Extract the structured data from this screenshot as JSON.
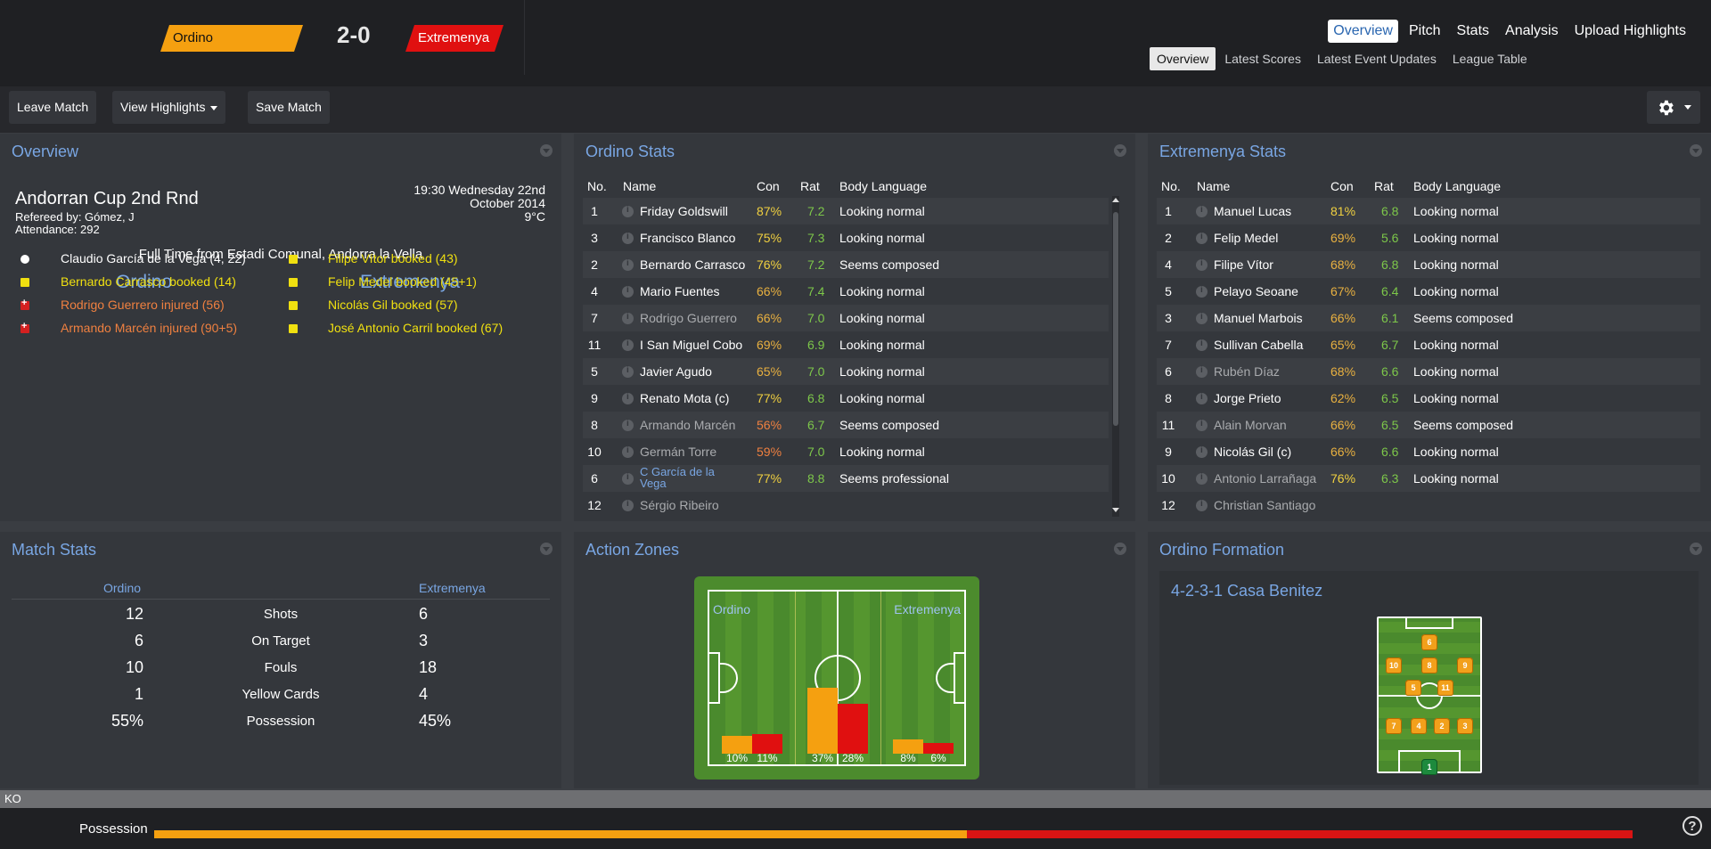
{
  "header": {
    "home_team": "Ordino",
    "away_team": "Extremenya",
    "score": "2-0",
    "colors": {
      "home": "#f5a010",
      "away": "#e01010"
    },
    "nav": [
      "Overview",
      "Pitch",
      "Stats",
      "Analysis",
      "Upload Highlights"
    ],
    "subnav": [
      "Overview",
      "Latest Scores",
      "Latest Event Updates",
      "League Table"
    ]
  },
  "toolbar": {
    "leave": "Leave Match",
    "highlights": "View Highlights",
    "save": "Save Match",
    "settings_icon": "gear-icon"
  },
  "overview": {
    "title": "Overview",
    "competition": "Andorran Cup 2nd Rnd",
    "referee": "Refereed by: Gómez, J",
    "attendance": "Attendance: 292",
    "datetime": "19:30 Wednesday 22nd October 2014",
    "temperature": "9°C",
    "fulltime": "Full Time from Estadi Comunal, Andorra la Vella",
    "home_label": "Ordino",
    "away_label": "Extremenya",
    "home_events": [
      {
        "text": "Claudio García de la Vega (4, 22)",
        "type": "goal"
      },
      {
        "text": "Bernardo Carrasco booked (14)",
        "type": "yellow"
      },
      {
        "text": "Rodrigo Guerrero injured (56)",
        "type": "injury"
      },
      {
        "text": "Armando Marcén injured (90+5)",
        "type": "injury"
      }
    ],
    "away_events": [
      {
        "text": "Filipe Vítor booked (43)",
        "type": "yellow"
      },
      {
        "text": "Felip Medel booked (45+1)",
        "type": "yellow"
      },
      {
        "text": "Nicolás Gil booked (57)",
        "type": "yellow"
      },
      {
        "text": "José Antonio Carril booked (67)",
        "type": "yellow"
      }
    ]
  },
  "stats_headers": {
    "no": "No.",
    "name": "Name",
    "con": "Con",
    "rat": "Rat",
    "body": "Body Language"
  },
  "home_stats": {
    "title": "Ordino Stats",
    "rows": [
      {
        "no": "1",
        "name": "Friday Goldswill",
        "con": "87%",
        "rat": "7.2",
        "body": "Looking normal",
        "dim": false
      },
      {
        "no": "3",
        "name": "Francisco Blanco",
        "con": "75%",
        "rat": "7.3",
        "body": "Looking normal",
        "dim": false
      },
      {
        "no": "2",
        "name": "Bernardo Carrasco",
        "con": "76%",
        "rat": "7.2",
        "body": "Seems composed",
        "dim": false
      },
      {
        "no": "4",
        "name": "Mario Fuentes",
        "con": "66%",
        "rat": "7.4",
        "body": "Looking normal",
        "dim": false
      },
      {
        "no": "7",
        "name": "Rodrigo Guerrero",
        "con": "66%",
        "rat": "7.0",
        "body": "Looking normal",
        "dim": true
      },
      {
        "no": "11",
        "name": "I San Miguel Cobo",
        "con": "69%",
        "rat": "6.9",
        "body": "Looking normal",
        "dim": false
      },
      {
        "no": "5",
        "name": "Javier Agudo",
        "con": "65%",
        "rat": "7.0",
        "body": "Looking normal",
        "dim": false
      },
      {
        "no": "9",
        "name": "Renato Mota (c)",
        "con": "77%",
        "rat": "6.8",
        "body": "Looking normal",
        "dim": false
      },
      {
        "no": "8",
        "name": "Armando Marcén",
        "con": "56%",
        "rat": "6.7",
        "body": "Seems composed",
        "dim": true
      },
      {
        "no": "10",
        "name": "Germán Torre",
        "con": "59%",
        "rat": "7.0",
        "body": "Looking normal",
        "dim": true
      },
      {
        "no": "6",
        "name": "C García de la Vega",
        "con": "77%",
        "rat": "8.8",
        "body": "Seems professional",
        "dim": false,
        "link": true
      },
      {
        "no": "12",
        "name": "Sérgio Ribeiro",
        "con": "",
        "rat": "",
        "body": "",
        "dim": true
      }
    ]
  },
  "away_stats": {
    "title": "Extremenya Stats",
    "rows": [
      {
        "no": "1",
        "name": "Manuel Lucas",
        "con": "81%",
        "rat": "6.8",
        "body": "Looking normal",
        "dim": false
      },
      {
        "no": "2",
        "name": "Felip Medel",
        "con": "69%",
        "rat": "5.6",
        "body": "Looking normal",
        "dim": false
      },
      {
        "no": "4",
        "name": "Filipe Vítor",
        "con": "68%",
        "rat": "6.8",
        "body": "Looking normal",
        "dim": false
      },
      {
        "no": "5",
        "name": "Pelayo Seoane",
        "con": "67%",
        "rat": "6.4",
        "body": "Looking normal",
        "dim": false
      },
      {
        "no": "3",
        "name": "Manuel Marbois",
        "con": "66%",
        "rat": "6.1",
        "body": "Seems composed",
        "dim": false
      },
      {
        "no": "7",
        "name": "Sullivan Cabella",
        "con": "65%",
        "rat": "6.7",
        "body": "Looking normal",
        "dim": false
      },
      {
        "no": "6",
        "name": "Rubén Díaz",
        "con": "68%",
        "rat": "6.6",
        "body": "Looking normal",
        "dim": true
      },
      {
        "no": "8",
        "name": "Jorge Prieto",
        "con": "62%",
        "rat": "6.5",
        "body": "Looking normal",
        "dim": false
      },
      {
        "no": "11",
        "name": "Alain Morvan",
        "con": "66%",
        "rat": "6.5",
        "body": "Seems composed",
        "dim": true
      },
      {
        "no": "9",
        "name": "Nicolás Gil (c)",
        "con": "66%",
        "rat": "6.6",
        "body": "Looking normal",
        "dim": false
      },
      {
        "no": "10",
        "name": "Antonio Larrañaga",
        "con": "76%",
        "rat": "6.3",
        "body": "Looking normal",
        "dim": true
      },
      {
        "no": "12",
        "name": "Christian Santiago",
        "con": "",
        "rat": "",
        "body": "",
        "dim": true
      }
    ]
  },
  "match_stats": {
    "title": "Match Stats",
    "home_label": "Ordino",
    "away_label": "Extremenya",
    "rows": [
      {
        "label": "Shots",
        "home": "12",
        "away": "6"
      },
      {
        "label": "On Target",
        "home": "6",
        "away": "3"
      },
      {
        "label": "Fouls",
        "home": "10",
        "away": "18"
      },
      {
        "label": "Yellow Cards",
        "home": "1",
        "away": "4"
      },
      {
        "label": "Possession",
        "home": "55%",
        "away": "45%"
      }
    ]
  },
  "action_zones": {
    "title": "Action Zones",
    "home_label": "Ordino",
    "away_label": "Extremenya",
    "zones": [
      {
        "home": 10,
        "away": 11,
        "home_label": "10%",
        "away_label": "11%"
      },
      {
        "home": 37,
        "away": 28,
        "home_label": "37%",
        "away_label": "28%"
      },
      {
        "home": 8,
        "away": 6,
        "home_label": "8%",
        "away_label": "6%"
      }
    ]
  },
  "formation": {
    "title": "Ordino Formation",
    "name": "4-2-3-1 Casa Benitez",
    "players": [
      "6",
      "10",
      "8",
      "9",
      "5",
      "11",
      "7",
      "4",
      "2",
      "3",
      "1"
    ]
  },
  "bottom": {
    "ko": "KO",
    "possession_label": "Possession",
    "possession_home": 0.55,
    "help_icon": "help-icon"
  }
}
